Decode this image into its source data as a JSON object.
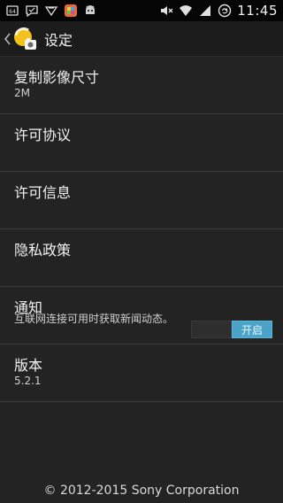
{
  "status_bar": {
    "time": "11:45",
    "notification_icons": [
      "sim-card-icon",
      "chat-bubble-icon",
      "bell-icon",
      "app-notification-icon",
      "android-debug-icon"
    ],
    "system_icons": [
      "mute-icon",
      "wifi-icon",
      "signal-icon",
      "battery-sync-icon"
    ]
  },
  "action_bar": {
    "title": "设定"
  },
  "settings": {
    "copy_image_size": {
      "title": "复制影像尺寸",
      "value": "2M"
    },
    "license_agreement": {
      "title": "许可协议"
    },
    "license_info": {
      "title": "许可信息"
    },
    "privacy_policy": {
      "title": "隐私政策"
    },
    "notifications": {
      "title": "通知",
      "description": "互联网连接可用时获取新闻动态。",
      "toggle_on_label": "开启"
    },
    "version": {
      "title": "版本",
      "value": "5.2.1"
    }
  },
  "footer": {
    "copyright": "© 2012-2015 Sony Corporation"
  },
  "colors": {
    "background": "#232323",
    "divider": "#3a3a3a",
    "toggle_accent": "#4ba3c7"
  }
}
